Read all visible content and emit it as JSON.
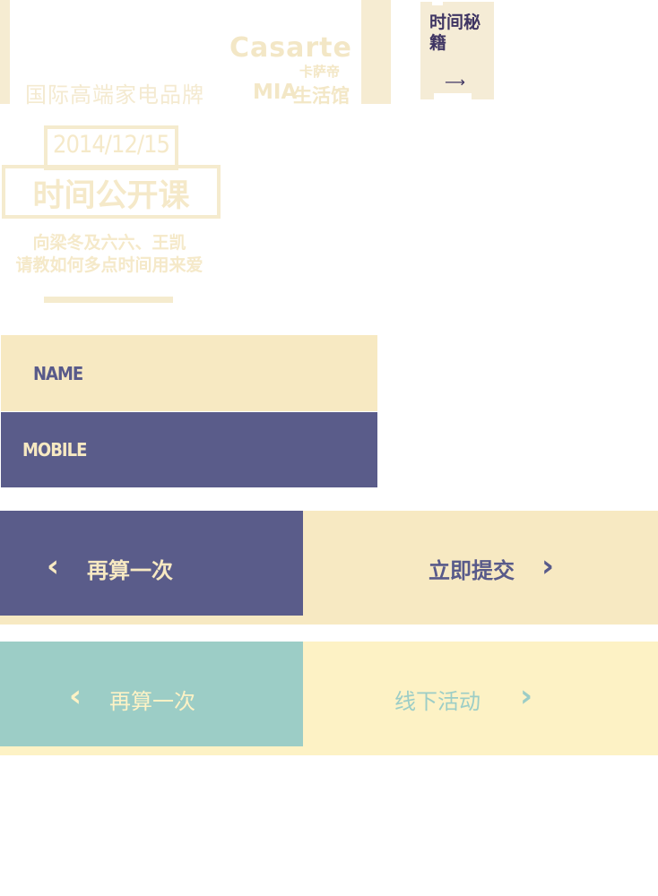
{
  "brand": {
    "tagline": "国际高端家电品牌",
    "casarte": "Casarte",
    "casarte_cn": "卡萨帝",
    "mia": "MIA",
    "mia_cn": "生活馆"
  },
  "tips_tab": {
    "title": "时间秘籍",
    "arrow": "⟶",
    "arrow_icon": "arrow-right-icon"
  },
  "course": {
    "date": "2014/12/15",
    "title": "时间公开课",
    "subtitle_1": "向梁冬及六六、王凯",
    "subtitle_2": "请教如何多点时间用来爱"
  },
  "form": {
    "name_label": "NAME",
    "mobile_label": "MOBILE"
  },
  "buttons": {
    "recalc_label": "再算一次",
    "submit_label": "立即提交",
    "offline_label": "线下活动",
    "left_chevron": "‹",
    "right_chevron": "›",
    "left_icon": "chevron-left-icon",
    "right_icon": "chevron-right-icon"
  },
  "colors": {
    "cream": "#f7e9c2",
    "indigo": "#5a5c8a",
    "teal": "#9ccdc6",
    "light_yellow": "#fdf2c5",
    "dark_purple": "#3f3563"
  }
}
